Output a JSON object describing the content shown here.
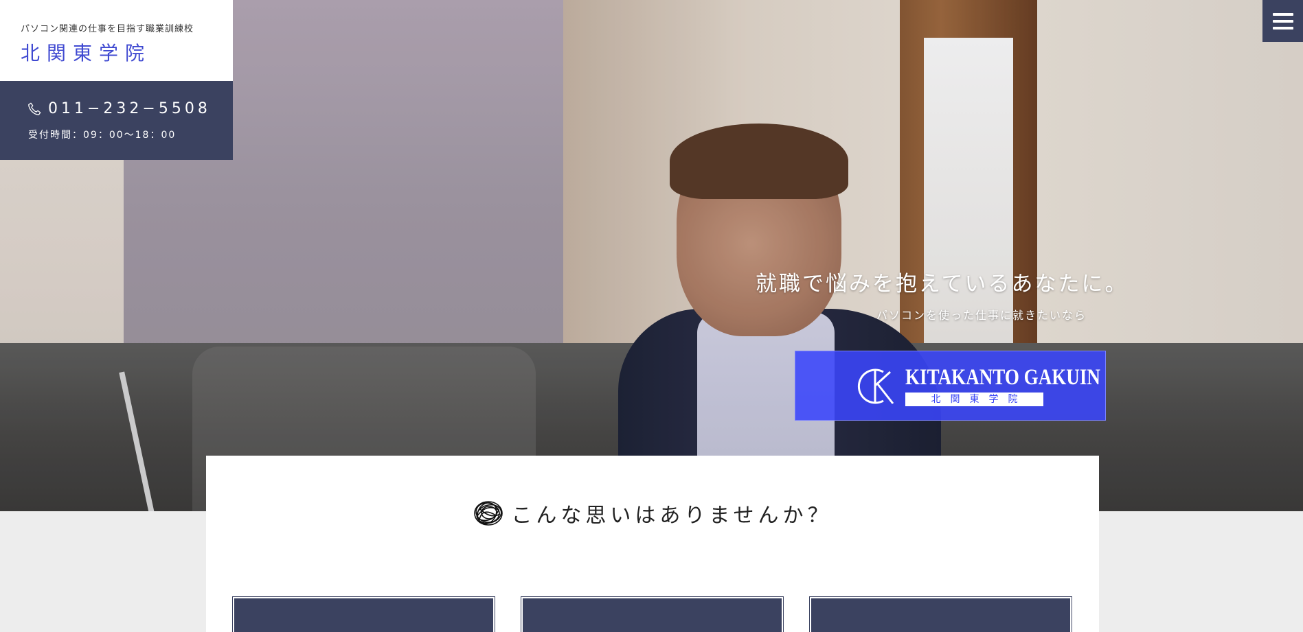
{
  "brand": {
    "tagline": "パソコン関連の仕事を目指す職業訓練校",
    "name": "北関東学院"
  },
  "contact": {
    "phone_icon": "phone-icon",
    "phone": "011−232−5508",
    "hours": "受付時間：09：00〜18：00"
  },
  "menu": {
    "icon": "hamburger-menu-icon"
  },
  "hero": {
    "catch": "就職で悩みを抱えているあなたに。",
    "subcatch": "パソコンを使った仕事に就きたいなら"
  },
  "logo": {
    "english": "KITAKANTO GAKUIN",
    "japanese": "北関東学院"
  },
  "section": {
    "icon": "scribble-icon",
    "title": "こんな思いはありませんか？"
  },
  "colors": {
    "navy": "#3b4260",
    "brand_blue": "#3a46f5",
    "background": "#ededed"
  }
}
